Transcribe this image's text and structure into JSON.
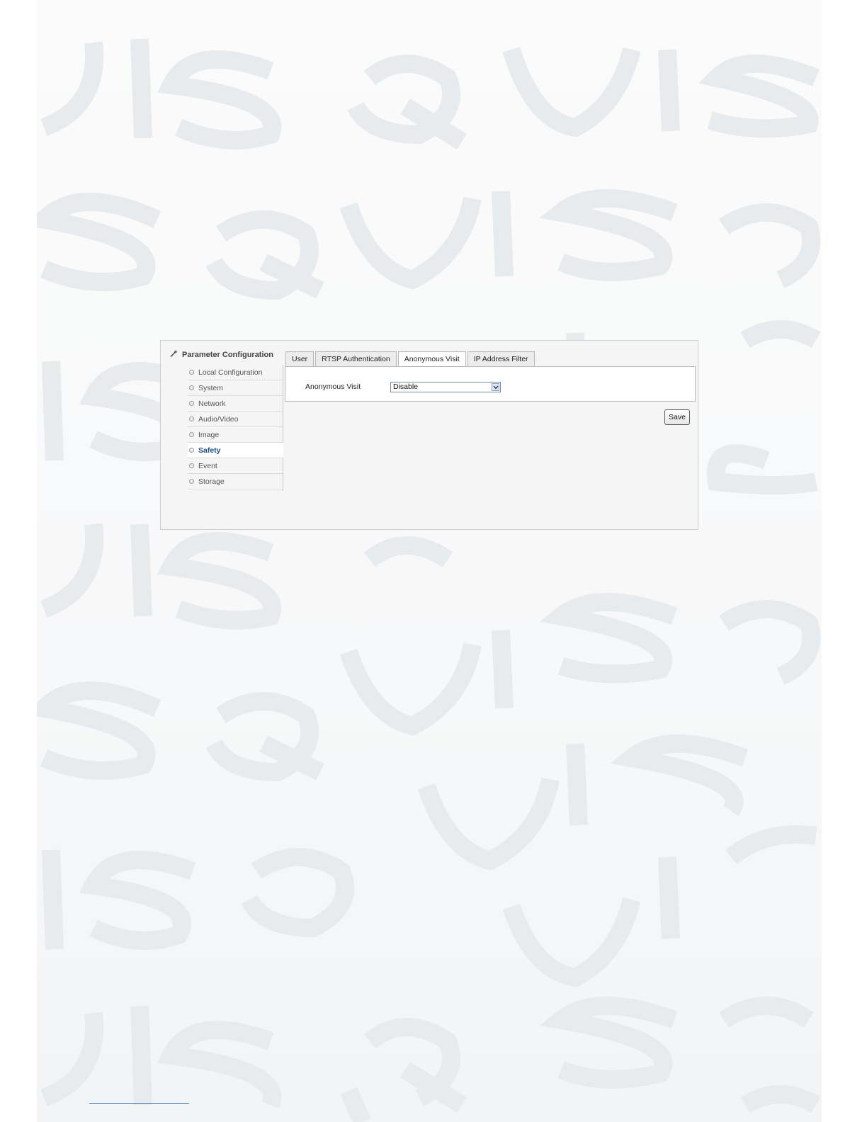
{
  "watermark": {
    "text": "VISQUIS",
    "color": "#e9ecef"
  },
  "panel": {
    "title": "Parameter Configuration",
    "title_icon": "wrench-icon"
  },
  "nav": {
    "items": [
      {
        "label": "Local Configuration",
        "active": false
      },
      {
        "label": "System",
        "active": false
      },
      {
        "label": "Network",
        "active": false
      },
      {
        "label": "Audio/Video",
        "active": false
      },
      {
        "label": "Image",
        "active": false
      },
      {
        "label": "Safety",
        "active": true
      },
      {
        "label": "Event",
        "active": false
      },
      {
        "label": "Storage",
        "active": false
      }
    ]
  },
  "tabs": [
    {
      "label": "User",
      "active": false
    },
    {
      "label": "RTSP Authentication",
      "active": false
    },
    {
      "label": "Anonymous Visit",
      "active": true
    },
    {
      "label": "IP Address Filter",
      "active": false
    }
  ],
  "form": {
    "anonymous_visit_label": "Anonymous Visit",
    "anonymous_visit_value": "Disable"
  },
  "actions": {
    "save_label": "Save"
  },
  "colors": {
    "active_nav": "#1b4d8c",
    "footer_link": "#3a6fb3"
  }
}
